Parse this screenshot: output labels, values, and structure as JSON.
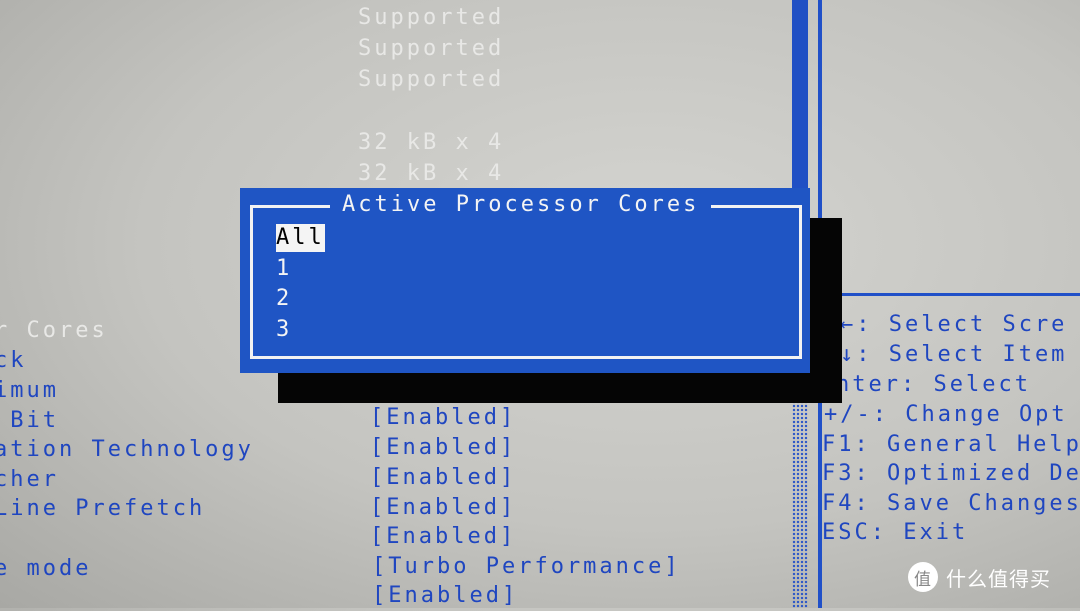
{
  "info_values": [
    "Supported",
    "Supported",
    "Supported",
    "32 kB x 4",
    "32 kB x 4"
  ],
  "settings": [
    {
      "label": "r Cores",
      "value": ""
    },
    {
      "label": "ck",
      "value": ""
    },
    {
      "label": "imum",
      "value": ""
    },
    {
      "label": " Bit",
      "value": "[Enabled]"
    },
    {
      "label": "ation Technology",
      "value": "[Enabled]"
    },
    {
      "label": "cher",
      "value": "[Enabled]"
    },
    {
      "label": "Line Prefetch",
      "value": "[Enabled]"
    },
    {
      "label": "",
      "value": "[Enabled]"
    },
    {
      "label": "e mode",
      "value": "[Turbo Performance]"
    },
    {
      "label": "",
      "value": "[Enabled]"
    }
  ],
  "popup": {
    "title": "Active Processor Cores",
    "options": [
      "All",
      "1",
      "2",
      "3"
    ],
    "selected": "All"
  },
  "help": [
    "←: Select Scre",
    "↓: Select Item",
    "nter: Select",
    "+/-: Change Opt",
    "F1: General Help",
    "F3: Optimized De",
    "F4: Save Changes",
    "ESC: Exit"
  ],
  "watermark": {
    "logo": "值",
    "text": "什么值得买"
  },
  "colors": {
    "popup_bg": "#1f55c4",
    "text_blue": "#1f46c0",
    "background": "#c8c8c4"
  }
}
